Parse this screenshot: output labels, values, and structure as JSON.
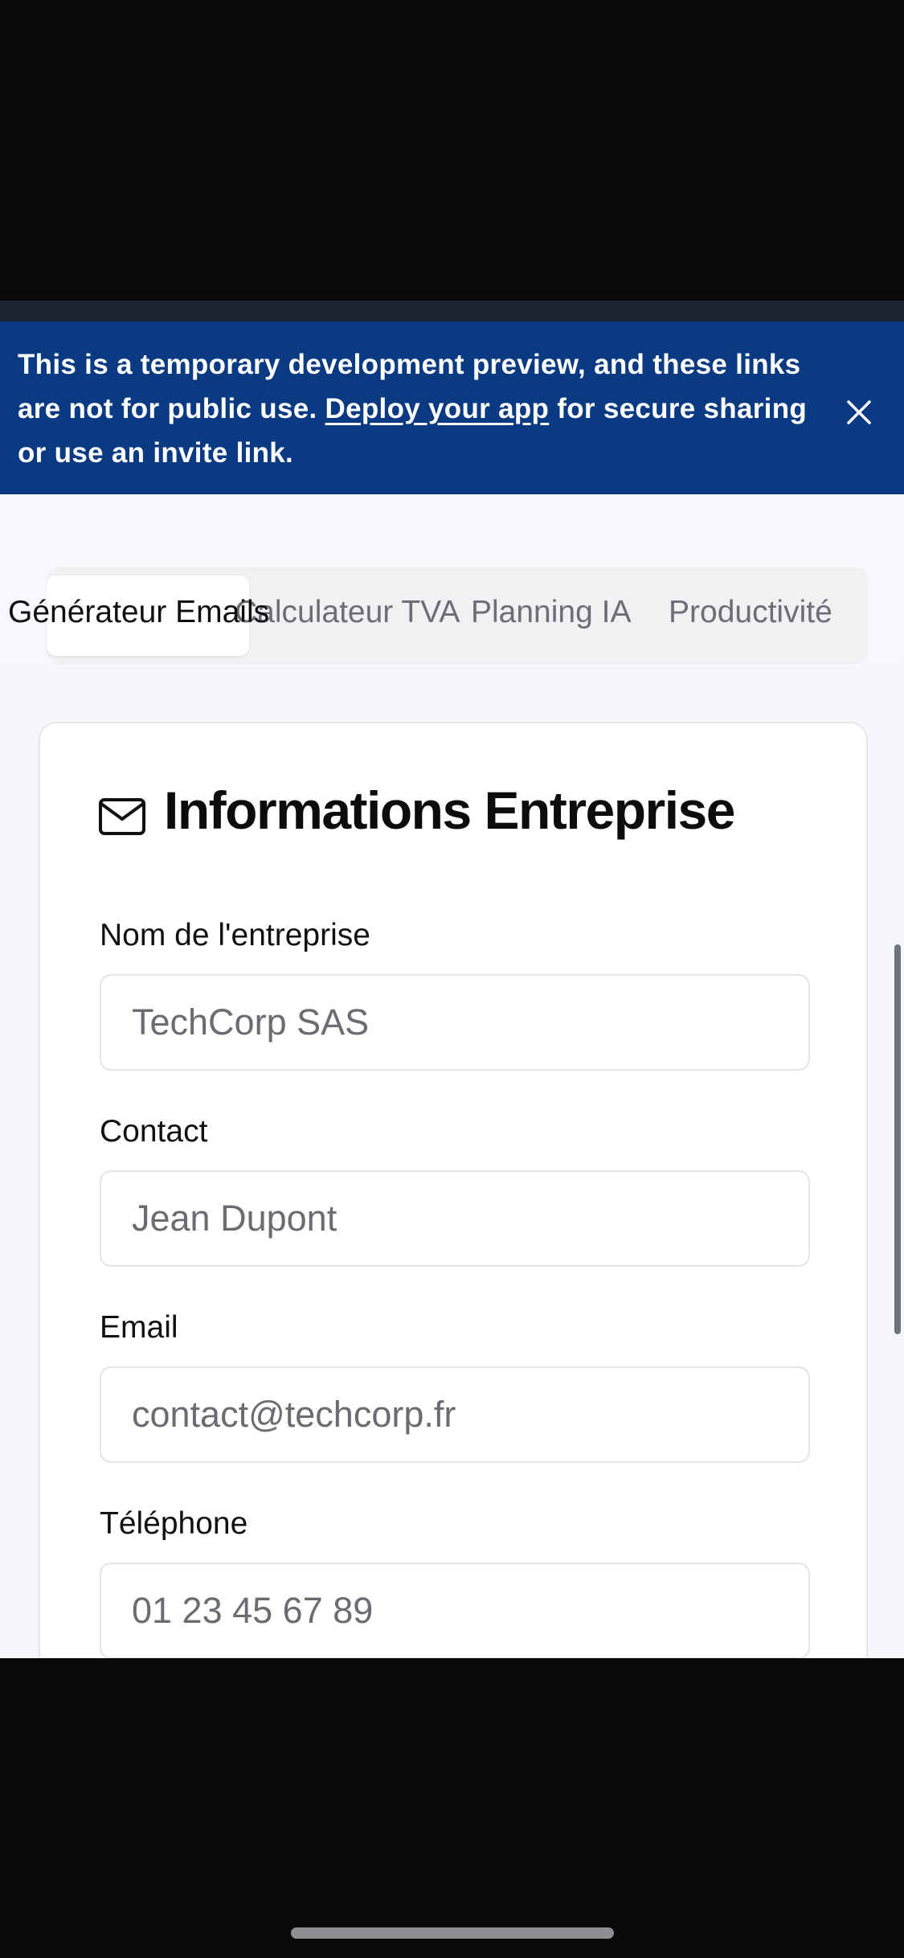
{
  "banner": {
    "text_before": "This is a temporary development preview, and these links are not for public use. ",
    "link_label": "Deploy your app",
    "text_after": " for secure sharing or use an invite link.",
    "close_icon": "close-icon",
    "background": "#0a3a82"
  },
  "tabs": [
    {
      "label": "Générateur Emails",
      "active": true
    },
    {
      "label": "Calculateur TVA",
      "active": false
    },
    {
      "label": "Planning IA",
      "active": false
    },
    {
      "label": "Productivité",
      "active": false
    }
  ],
  "card": {
    "icon": "mail-icon",
    "title": "Informations Entreprise",
    "fields": [
      {
        "label": "Nom de l'entreprise",
        "placeholder": "TechCorp SAS"
      },
      {
        "label": "Contact",
        "placeholder": "Jean Dupont"
      },
      {
        "label": "Email",
        "placeholder": "contact@techcorp.fr"
      },
      {
        "label": "Téléphone",
        "placeholder": "01 23 45 67 89"
      }
    ]
  }
}
